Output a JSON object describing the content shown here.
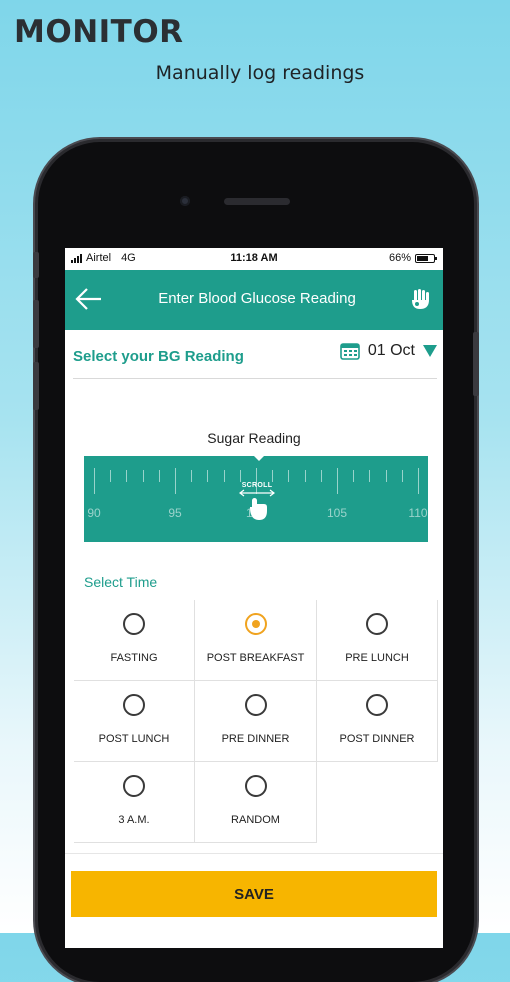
{
  "promo": {
    "title": "MONITOR",
    "subtitle": "Manually log readings"
  },
  "status_bar": {
    "carrier": "Airtel",
    "network": "4G",
    "time": "11:18 AM",
    "battery": "66%"
  },
  "header": {
    "title": "Enter Blood Glucose Reading",
    "back_icon": "arrow-left-icon",
    "action_icon": "hand-icon"
  },
  "bg_reading": {
    "label": "Select your BG Reading",
    "date": "01 Oct",
    "calendar_icon": "calendar-icon",
    "dropdown_icon": "caret-down-icon"
  },
  "sugar": {
    "label": "Sugar Reading",
    "scroll_hint": "SCROLL",
    "ticks": [
      "90",
      "95",
      "100",
      "105",
      "110"
    ]
  },
  "select_time": {
    "label": "Select Time",
    "options": [
      {
        "label": "FASTING",
        "selected": false
      },
      {
        "label": "POST BREAKFAST",
        "selected": true
      },
      {
        "label": "PRE LUNCH",
        "selected": false
      },
      {
        "label": "POST LUNCH",
        "selected": false
      },
      {
        "label": "PRE DINNER",
        "selected": false
      },
      {
        "label": "POST DINNER",
        "selected": false
      },
      {
        "label": "3 A.M.",
        "selected": false
      },
      {
        "label": "RANDOM",
        "selected": false
      }
    ]
  },
  "save_label": "SAVE",
  "colors": {
    "teal": "#1e9d8c",
    "save": "#f7b500",
    "radio_selected": "#f0a31f"
  }
}
